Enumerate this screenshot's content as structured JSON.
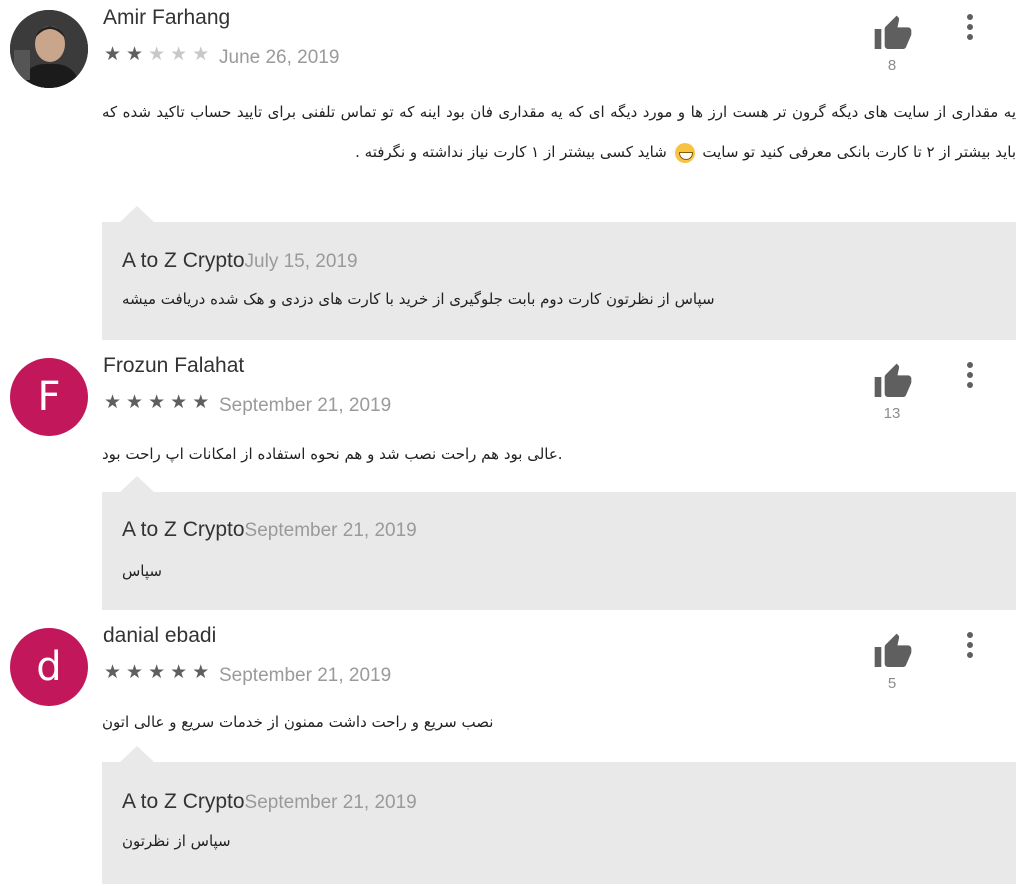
{
  "reviews": [
    {
      "author": "Amir Farhang",
      "avatar": {
        "kind": "photo",
        "letter": ""
      },
      "rating": 2,
      "date": "June 26, 2019",
      "likes": "8",
      "text": "یه مقداری از سایت های دیگه گرون تر هست ارز ها و مورد دیگه ای که یه مقداری فان بود اینه که تو تماس تلفنی برای تایید حساب تاکید شده که باید بیشتر از ۲ تا کارت بانکی معرفی کنید تو سایت 😁 شاید کسی بیشتر از ۱ کارت نیاز نداشته و نگرفته .",
      "reply": {
        "developer": "A to Z Crypto",
        "date": "July 15, 2019",
        "text": "سپاس از نظرتون کارت دوم بابت جلوگیری از خرید با کارت های دزدی و هک شده دریافت میشه"
      }
    },
    {
      "author": "Frozun Falahat",
      "avatar": {
        "kind": "letter",
        "letter": "F"
      },
      "rating": 5,
      "date": "September 21, 2019",
      "likes": "13",
      "text": ".عالی بود هم راحت نصب شد و هم نحوه استفاده از امکانات اپ راحت بود",
      "reply": {
        "developer": "A to Z Crypto",
        "date": "September 21, 2019",
        "text": "سپاس"
      }
    },
    {
      "author": "danial ebadi",
      "avatar": {
        "kind": "letter",
        "letter": "d"
      },
      "rating": 5,
      "date": "September 21, 2019",
      "likes": "5",
      "text": "نصب سریع و راحت داشت ممنون از خدمات سریع و عالی اتون",
      "reply": {
        "developer": "A to Z Crypto",
        "date": "September 21, 2019",
        "text": "سپاس از نظرتون"
      }
    }
  ],
  "icons": {
    "like": "thumbs-up-icon",
    "more": "more-vert-icon",
    "star": "star-icon"
  },
  "colors": {
    "avatar_accent": "#c2185b",
    "reply_background": "#e9e9e9",
    "star_filled": "#5f5f5f",
    "star_empty": "#c8c8c8"
  }
}
